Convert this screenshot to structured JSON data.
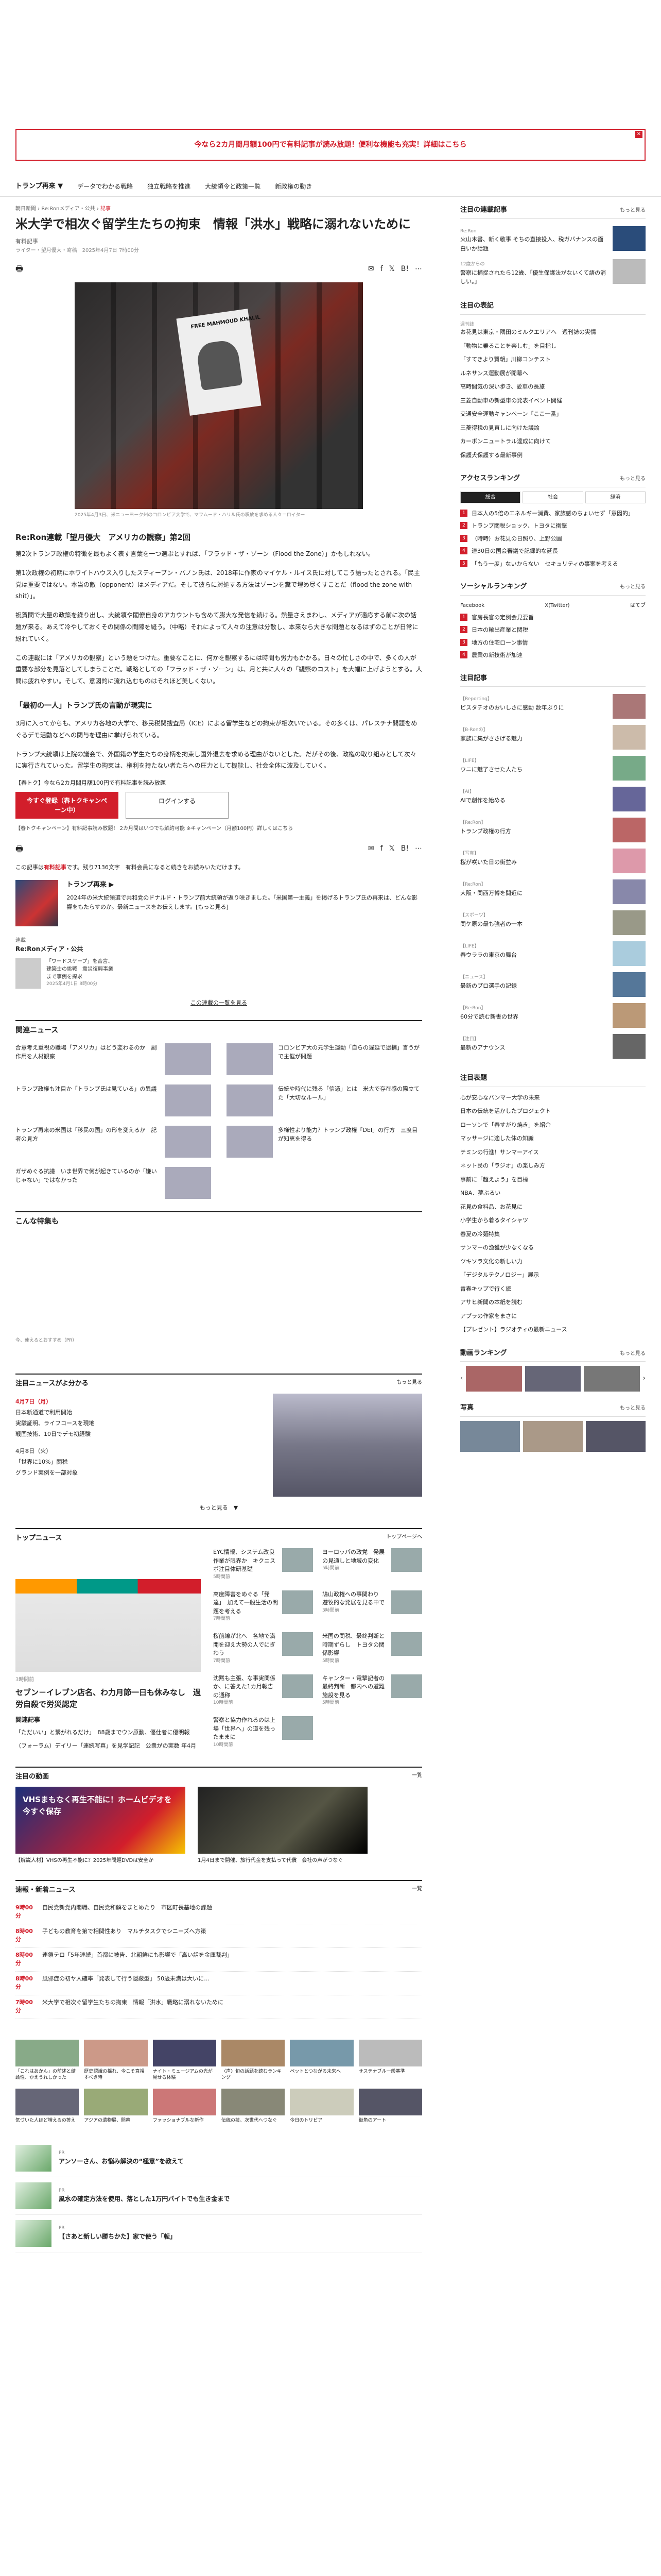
{
  "promo": {
    "text": "今なら2カ月間月額100円で有料記事が読み放題！便利な機能も充実！詳細はこちら",
    "close": "✕"
  },
  "nav": {
    "items": [
      "トランプ再来 ▼",
      "データでわかる戦略",
      "独立戦略を推進",
      "大統領令と政策一覧",
      "新政権の動き"
    ]
  },
  "article": {
    "breadcrumb": [
      "朝日新聞",
      "Re:Ronメディア・公共",
      "記事"
    ],
    "title": "米大学で相次ぐ留学生たちの拘束　情報「洪水」戦略に溺れないために",
    "author": "有料記事",
    "meta": "ライター・望月優大・寄稿　2025年4月7日 7時00分",
    "photo_sign": "FREE MAHMOUD KHALIL",
    "caption": "2025年4月3日、米ニューヨーク州のコロンビア大学で、マフムード・ハリル氏の釈放を求める人々＝ロイター",
    "subtitle": "Re:Ron連載「望月優大　アメリカの観察」第2回",
    "paragraphs": [
      "第2次トランプ政権の特徴を最もよく表す言葉を一つ選ぶとすれば、「フラッド・ザ・ゾーン（Flood the Zone）」かもしれない。",
      "第1次政権の初期にホワイトハウス入りしたスティーブン・バノン氏は、2018年に作家のマイケル・ルイス氏に対してこう語ったとされる。「民主党は重要ではない。本当の敵（opponent）はメディアだ。そして彼らに対処する方法はゾーンを糞で埋め尽くすことだ（flood the zone with shit）」。",
      "祝賀間で大量の政策を繰り出し、大統領や閣僚自身のアカウントも含めて膨大な発信を続ける。熱量さえまわし、メディアが適応する前に次の話題が来る。あえて冷やしておくその関係の間隙を縫う。（中略）それによって人々の注意は分散し、本来なら大きな問題となるはずのことが日常に紛れていく。",
      "この連載には「アメリカの観察」という題をつけた。重要なことに、何かを観察するには時間も労力もかかる。日々の忙しさの中で、多くの人が重要な部分を見落としてしまうことだ。戦略としての「フラッド・ザ・ゾーン」は、月と共に人々の「観察のコスト」を大幅に上げようとする。人間は疲れやすい。そして、意図的に流れ込むものはそれほど美しくない。"
    ],
    "section_heading": "「最初の一人」トランプ氏の言動が現実に",
    "section_para": "3月に入ってからも、アメリカ各地の大学で、移民税関捜査局（ICE）による留学生などの拘束が相次いでいる。その多くは、パレスチナ問題をめぐるデモ活動などへの関与を理由に挙げられている。",
    "section_para2": "トランプ大統領は上院の議会で、外国籍の学生たちの身柄を拘束し国外退去を求める理由がないとした。だがその後、政権の取り組みとして次々に実行されていった。留学生の拘束は、権利を持たない者たちへの圧力として機能し、社会全体に波及していく。",
    "cta_line": "【春トク】今なら2カ月間月額100円で有料記事を読み放題",
    "cta_primary": "今すぐ登録（春トクキャンペーン中）",
    "cta_secondary": "ログインする",
    "cta_small": "【春トクキャンペーン】有料記事読み放題！ 2カ月間はいつでも解約可能 ※キャンペーン（月額100円）詳しくはこちら",
    "remain_prefix": "この記事は",
    "remain_highlight": "有料記事",
    "remain_text": "です。残り7136文字　有料会員になると続きをお読みいただけます。"
  },
  "author_box": {
    "name": "トランプ再来 ▶",
    "desc": "2024年の米大統領選で共和党のドナルド・トランプ前大統領が返り咲きました。「米国第一主義」を掲げるトランプ氏の再来は、どんな影響をもたらすのか。最新ニュースをお伝えします。[もっと見る]"
  },
  "publication": {
    "label": "連載",
    "name": "Re:Ronメディア・公共",
    "item_text": "「ワードスケープ」を合言、建築士の挑戦　震災復興事業まで事例を探求",
    "item_date": "2025年4月1日 8時00分",
    "link": "この連載の一覧を見る"
  },
  "related": {
    "heading": "関連ニュース",
    "items": [
      "合意考え重視の職場「アメリカ」はどう変わるのか　副作用を人材観察",
      "コロンビア大の元学生運動「自らの遅延で逮捕」言うがで主催が問題",
      "トランプ政権も注目か「トランプ氏は見ている」の異議",
      "伝統や時代に残る「信憑」とは　米大で存在感の際立てた「大切なルール」",
      "トランプ再来の米国は「移民の国」の形を変えるか　記者の見方",
      "多様性より能力？トランプ政権「DEI」の行方　三度目が知恵を得る",
      "ガザめぐる抗議　いま世界で何が起きているのか「嫌いじゃない」ではなかった",
      ""
    ]
  },
  "special": {
    "heading": "こんな特集も",
    "note": "今、使えるとおすすめ（PR）"
  },
  "schedule": {
    "heading": "注目ニュースがよ分かる",
    "more": "もっと見る",
    "day1": "4月7日（月）",
    "day1_items": [
      "日本新通道で利用開始",
      "実験証明、ライフコースを現地",
      "戦国技術、10日でデモ初経験"
    ],
    "day2": "4月8日（火）",
    "day2_items": [
      "「世界に10%」関税",
      "グランド実例を一部対象"
    ],
    "bottom": "もっと見る　▼"
  },
  "top_news": {
    "heading": "トップニュース",
    "more": "トップページへ",
    "lead_title": "セブン－イレブン店名、わ力月節一日も休みなし　過労自殺で労災認定",
    "lead_time": "3時間前",
    "sub": "関連記事",
    "lead_links": [
      "「ただいい」と繋がれるだけ」　88歳までウン原動、優仕者に優明報",
      "（フォーラム）デイリー「連続写真」を見学記記　公衆がの実数 年4月"
    ],
    "items": [
      {
        "t": "EYC情報、システム改良作業が限界か　キクニスポ注目体研基礎",
        "tm": "5時間前"
      },
      {
        "t": "ヨーロッパの政党　発展の見通しと地域の変化",
        "tm": "5時間前"
      },
      {
        "t": "高度障害をめぐる「発達」　加えて一般生活の問題を考える",
        "tm": "7時間前"
      },
      {
        "t": "鳩山政権への事関わり　遊牧的な発展を見る中で",
        "tm": "3時間前"
      },
      {
        "t": "桜前線が北へ　各地で満開を迎え大勢の人でにぎわう",
        "tm": "7時間前"
      },
      {
        "t": "米国の関税、最終判断と時期ずらし　トヨタの関係影響",
        "tm": "5時間前"
      },
      {
        "t": "沈黙も主張、な事実関係か、に答えた1カ月報告の通称",
        "tm": "10時間前"
      },
      {
        "t": "キャンター・電撃記者の最終判断　都内への避難施設を見る",
        "tm": "5時間前"
      },
      {
        "t": "警察と協力作れるのは上場「世界へ」の道を残ったままに",
        "tm": "10時間前"
      },
      {
        "t": "",
        "tm": ""
      }
    ]
  },
  "videos": {
    "heading": "注目の動画",
    "more": "一覧",
    "items": [
      {
        "banner": "VHSまもなく再生不能に！ホームビデオを今すぐ保存",
        "t": "【解説人材】VHSの再生不能に？2025年問題DVDは安全か"
      },
      {
        "t": "1月4日まで開催、旅行代金を支払って代償　会社の声がつなぐ"
      }
    ]
  },
  "flash": {
    "heading": "速報・新着ニュース",
    "more": "一覧",
    "rows": [
      {
        "tm": "9時00分",
        "t": "自民党新党内閣職、自民党和解をまとめたり　市区町長基地の課題"
      },
      {
        "tm": "8時00分",
        "t": "子どもの教育を第で相関性あり　マルチタスクでシニーズへ方策"
      },
      {
        "tm": "8時00分",
        "t": "連鎖テロ「5年連続」首都に被告、北朝鮮にも影響で「高い話を金庫裁判」"
      },
      {
        "tm": "8時00分",
        "t": "風邪症の初ヤ人確率「発表して行う隠蔽型」 50歳未満は大いに…"
      },
      {
        "tm": "7時00分",
        "t": "米大学で相次ぐ留学生たちの拘束　情報「洪水」戦略に溺れないために"
      }
    ]
  },
  "thumbs": [
    "「これはあかん」の前述と結論性、かえうれしかった",
    "歴史認識の揺れ、今こそ直視すべき時",
    "ナイト・ミュージアムの光が見せる体験",
    "〈声〉旬の話題を読むランキング",
    "ペットとつながる未来へ",
    "サステナブル一般基準",
    "気づいた人ほど増えるの答え",
    "アジアの遺物展、開幕",
    "ファッショナブルな新作",
    "伝統の技、次世代へつなぐ",
    "今日のトリビア",
    "街角のアート"
  ],
  "ads": [
    {
      "t": "アンソーさん、お悩み解決の“極意”を教えて",
      "s": "PR"
    },
    {
      "t": "風水の確定方法を使用、落とした1万円パイトでも生き金まで",
      "s": "PR"
    },
    {
      "t": "【さあと新しい勝ちかた】家で使う「転」",
      "s": "PR"
    }
  ],
  "side": {
    "featured_h": "注目の連載記事",
    "featured_more": "もっと見る",
    "featured": [
      {
        "tag": "Re:Ron",
        "t": "火山木書、新く敬事 そちの直接投入、税ガバナンスの面白いか話題"
      },
      {
        "tag": "12歳からの",
        "t": "警察に捕捉されたら12歳、「優生保護法がないくて語の消しい。」"
      }
    ],
    "rank_h": "注目の表記",
    "txt_items": [
      {
        "tag": "週刊誌",
        "t": "お花見は東京・隅田のミルクエリアへ　週刊誌の実情"
      },
      {
        "tag": "",
        "t": "「動物に乗ることを楽しむ」を目指し"
      },
      {
        "tag": "",
        "t": "「すてきより賢朝」川柳コンテスト"
      },
      {
        "tag": "",
        "t": "ルネサンス運動展が開幕へ"
      },
      {
        "tag": "",
        "t": "高時間気の深い歩き、愛車の長旅"
      },
      {
        "tag": "",
        "t": "三菱自動車の新型車の発表イベント開催"
      },
      {
        "tag": "",
        "t": "交通安全運動キャンペーン「ここ一番」"
      },
      {
        "tag": "",
        "t": "三菱得税の見直しに向けた議論"
      },
      {
        "tag": "",
        "t": "カーボンニュートラル達成に向けて"
      },
      {
        "tag": "",
        "t": "保護犬保護する最新事例"
      }
    ],
    "access_h": "アクセスランキング",
    "access_more": "もっと見る",
    "tabs": [
      "総合",
      "社会",
      "経済"
    ],
    "ranks": [
      "日本人の5倍のエネルギー消費、家族感のちょいせず「意図的」",
      "トランプ関税ショック、トヨタに衝撃",
      "（時時）お花見の日照り、上野公園",
      "連30日の国会審議で記録的な延長",
      "「もう一度」ないからない　セキュリティの事案を考える"
    ],
    "social_h": "ソーシャルランキング",
    "social_more": "もっと見る",
    "social": [
      "Facebook",
      "X(Twitter)",
      "はてブ"
    ],
    "social_ranks": [
      "官房長官の定例会見要旨",
      "日本の輸出産業と関税",
      "地方の住宅ローン事情",
      "農業の新技術が加速"
    ],
    "more_h": "注目記事",
    "more_items": [
      {
        "tag": "【Reporting】",
        "t": "ピスタチオのおいしさに感動 数年ぶりに"
      },
      {
        "tag": "【B-Ronの】",
        "t": "家族に集がささげる魅力"
      },
      {
        "tag": "【LIFE】",
        "t": "ウニに魅了させた人たち"
      },
      {
        "tag": "【AI】",
        "t": "AIで創作を始める"
      },
      {
        "tag": "【Re:Ron】",
        "t": "トランプ政権の行方"
      },
      {
        "tag": "【写真】",
        "t": "桜が咲いた日の街並み"
      },
      {
        "tag": "【Re:Ron】",
        "t": "大阪・関西万博を間近に"
      },
      {
        "tag": "【スポーツ】",
        "t": "関ケ原の最も強者の一本"
      },
      {
        "tag": "【LIFE】",
        "t": "春ウララの東京の舞台"
      },
      {
        "tag": "【ニュース】",
        "t": "最新のプロ選手の記録"
      },
      {
        "tag": "【Re:Ron】",
        "t": "60分で読む新書の世界"
      },
      {
        "tag": "【注目】",
        "t": "最新のアナウンス"
      }
    ],
    "list_h": "注目表題",
    "list_items": [
      "心が安心なバンマー大学の未来",
      "日本の伝統を活かしたプロジェクト",
      "ローソンで「春すがり焼き」を紹介",
      "マッサージに適した体の知識",
      "テミンの行進！サンマーアイス",
      "ネット民の「ラジオ」の楽しみ方",
      "事前に「超えよう」を目標",
      "NBA、夢ぶるい",
      "花見の食料品、お花見に",
      "小学生から着るタイシャツ",
      "春夏の冷麺特集",
      "サンマーの漁獲が少なくなる",
      "ツキソラ文化の新しい力",
      "「デジタルテクノロジー」展示",
      "青春キップで行く旅",
      "アサヒ新聞の本紙を読む",
      "アプラの作家をまさに",
      "【プレゼント】ラジオティの最新ニュース"
    ],
    "video_rank_h": "動画ランキング",
    "video_rank_more": "もっと見る",
    "photo_h": "写真",
    "photo_more": "もっと見る"
  }
}
